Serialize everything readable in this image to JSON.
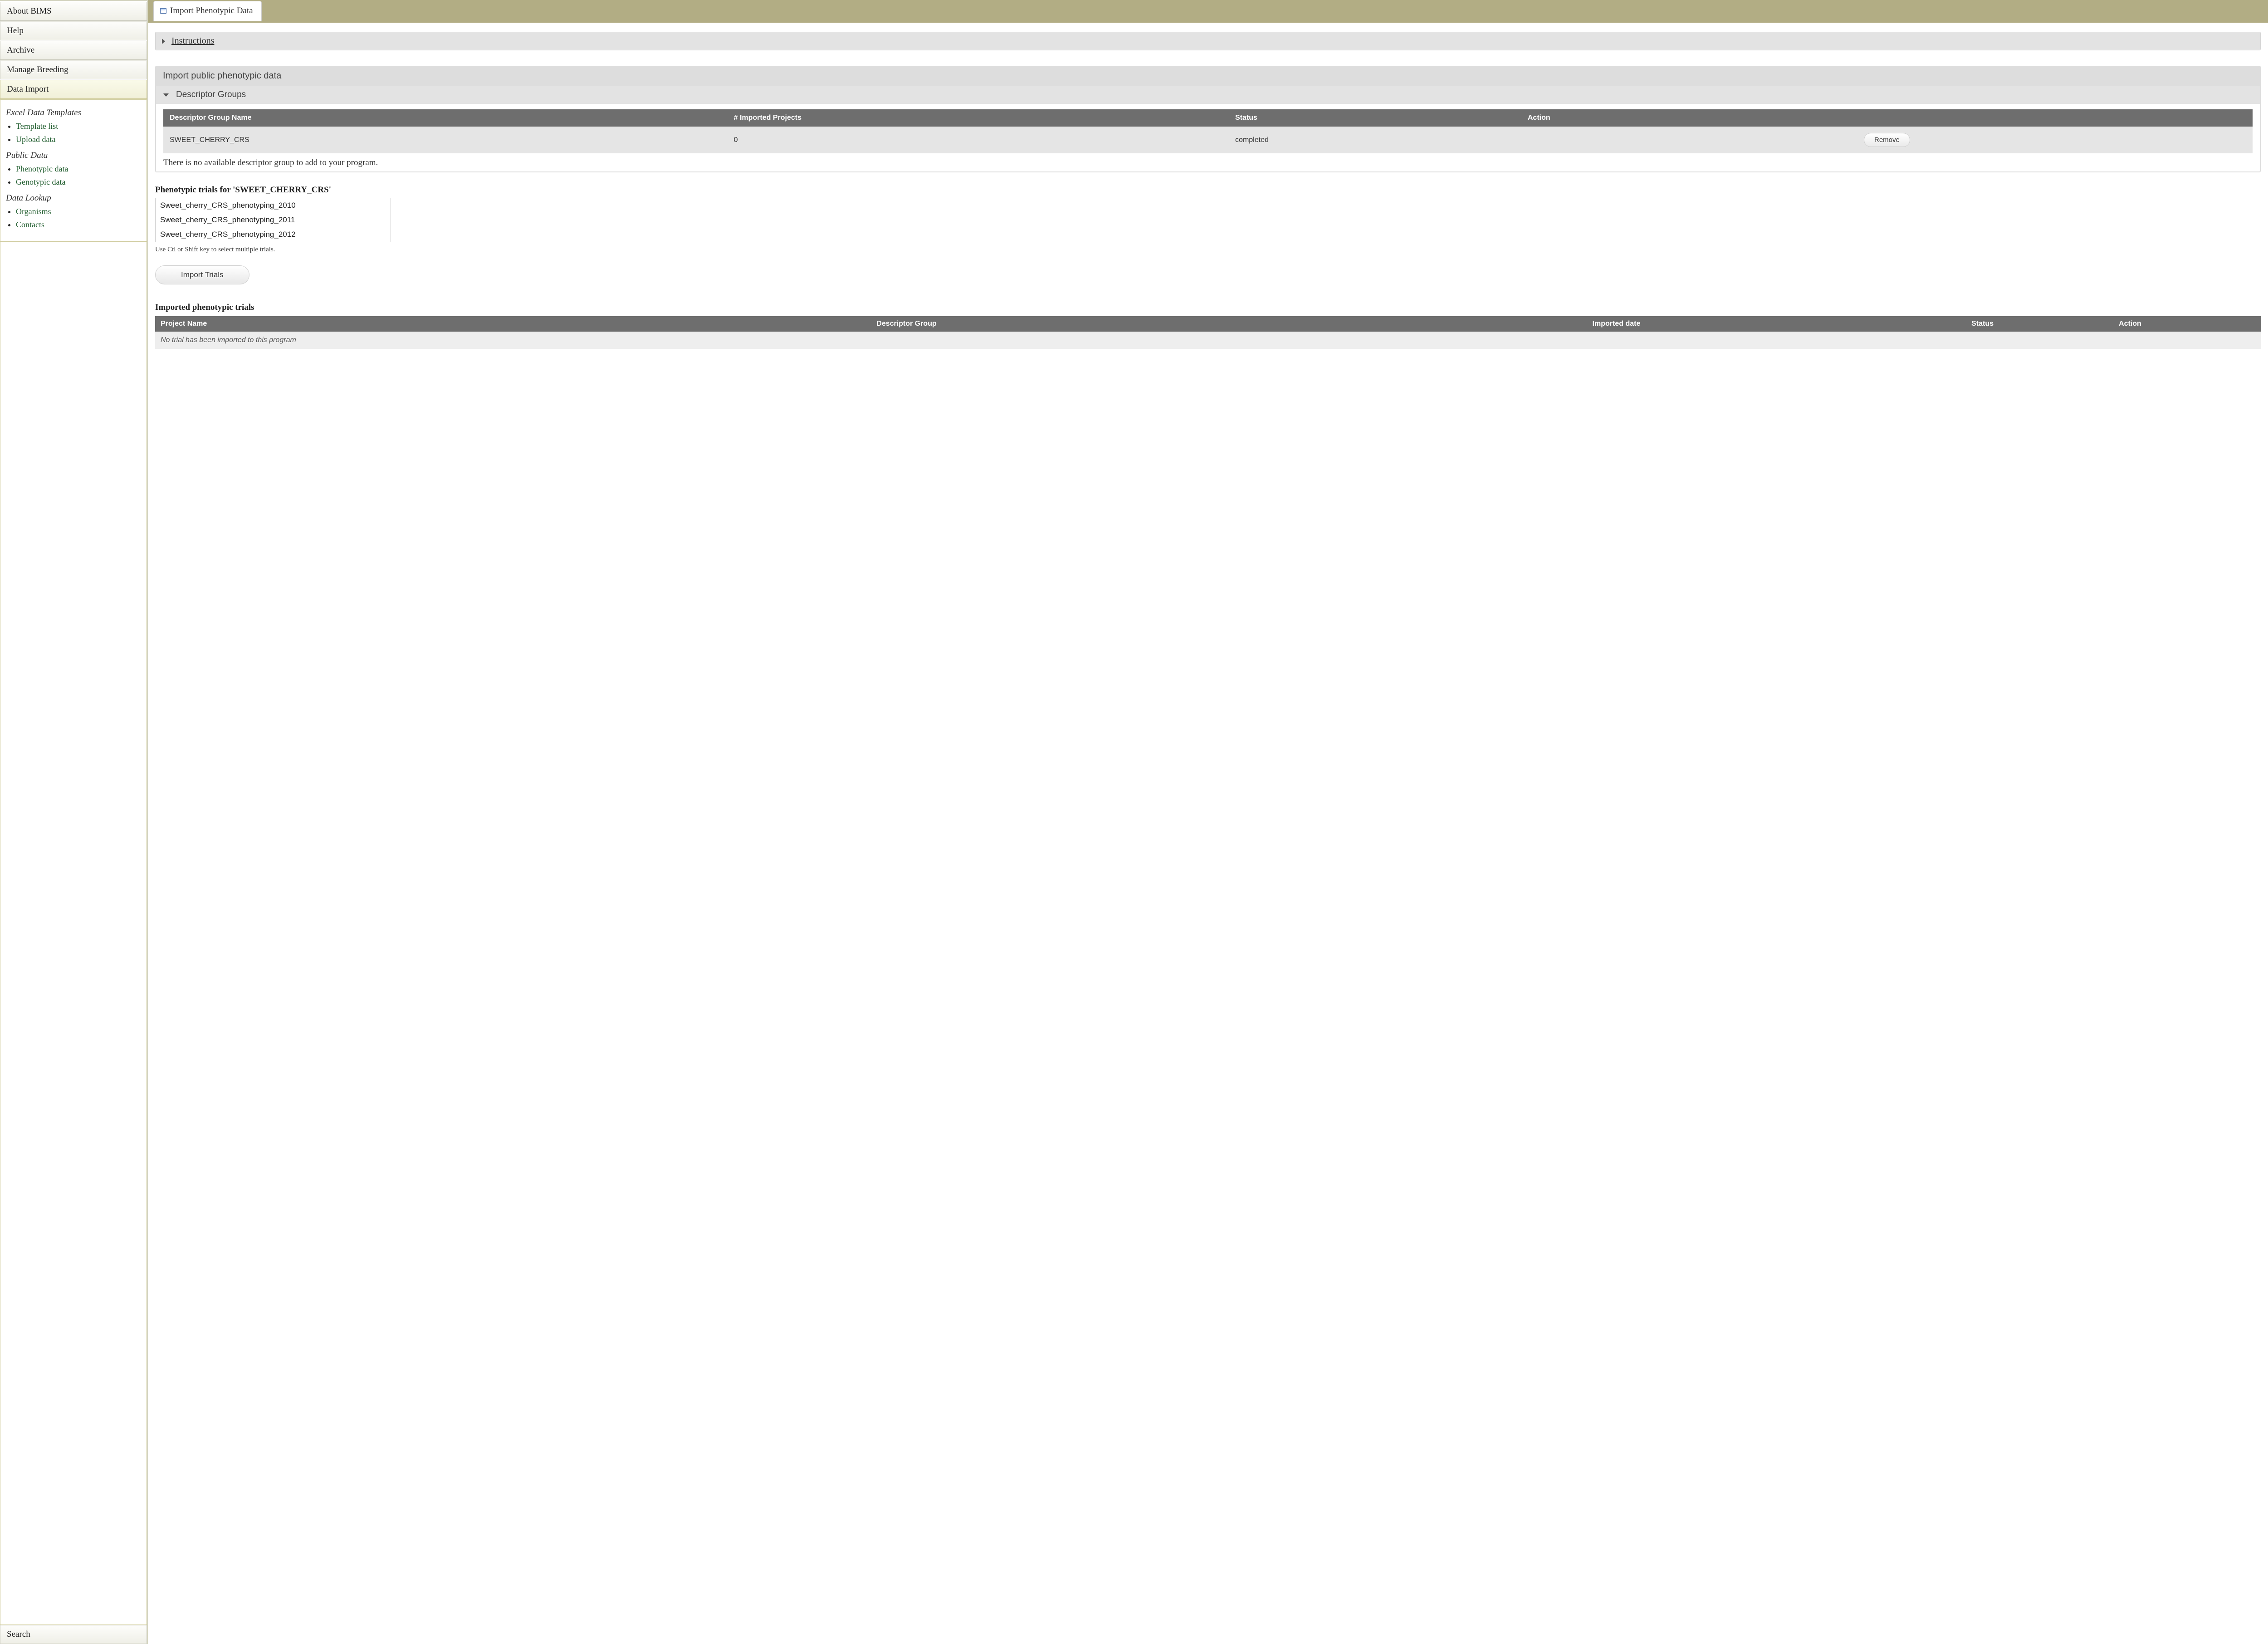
{
  "sidebar": {
    "items": [
      "About BIMS",
      "Help",
      "Archive",
      "Manage Breeding",
      "Data Import"
    ],
    "active": "Data Import",
    "search": "Search",
    "groups": [
      {
        "heading": "Excel Data Templates",
        "links": [
          "Template list",
          "Upload data"
        ]
      },
      {
        "heading": "Public Data",
        "links": [
          "Phenotypic data",
          "Genotypic data"
        ]
      },
      {
        "heading": "Data Lookup",
        "links": [
          "Organisms",
          "Contacts"
        ]
      }
    ]
  },
  "tab": {
    "title": "Import Phenotypic Data"
  },
  "instructions": {
    "label": "Instructions"
  },
  "panel": {
    "title": "Import public phenotypic data",
    "descriptor": {
      "title": "Descriptor Groups",
      "columns": [
        "Descriptor Group Name",
        "# Imported Projects",
        "Status",
        "Action"
      ],
      "rows": [
        {
          "name": "SWEET_CHERRY_CRS",
          "projects": "0",
          "status": "completed",
          "action": "Remove"
        }
      ],
      "empty_note": "There is no available descriptor group to add to your program."
    }
  },
  "trials": {
    "title": "Phenotypic trials for 'SWEET_CHERRY_CRS'",
    "options": [
      "Sweet_cherry_CRS_phenotyping_2010",
      "Sweet_cherry_CRS_phenotyping_2011",
      "Sweet_cherry_CRS_phenotyping_2012"
    ],
    "hint": "Use Ctl or Shift key to select multiple trials.",
    "import_btn": "Import Trials"
  },
  "imported": {
    "title": "Imported phenotypic trials",
    "columns": [
      "Project Name",
      "Descriptor Group",
      "Imported date",
      "Status",
      "Action"
    ],
    "empty": "No trial has been imported to this program"
  }
}
